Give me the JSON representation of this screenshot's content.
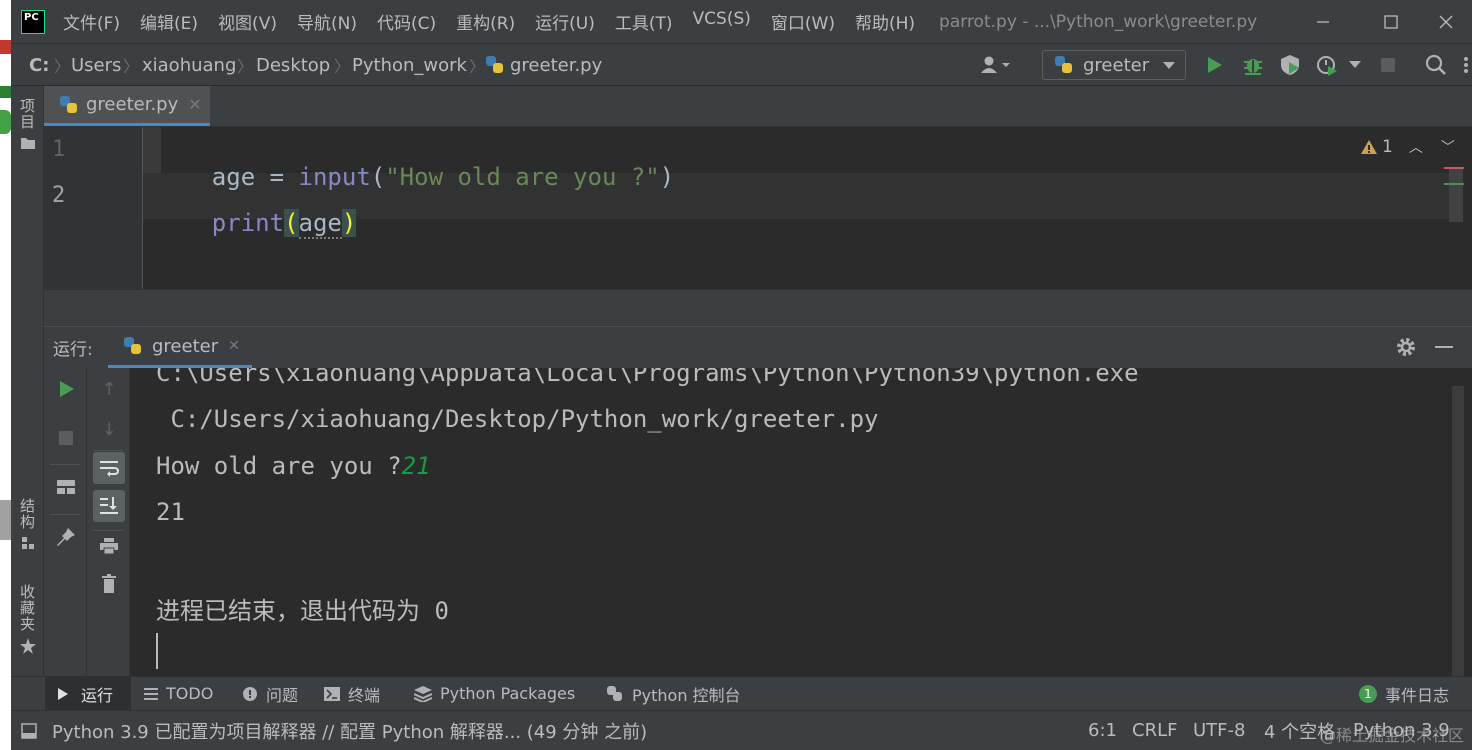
{
  "app": {
    "logo_text": "PC"
  },
  "menu": [
    "文件(F)",
    "编辑(E)",
    "视图(V)",
    "导航(N)",
    "代码(C)",
    "重构(R)",
    "运行(U)",
    "工具(T)",
    "VCS(S)",
    "窗口(W)",
    "帮助(H)"
  ],
  "window_title": "parrot.py - ...\\Python_work\\greeter.py",
  "breadcrumb": [
    "C:",
    "Users",
    "xiaohuang",
    "Desktop",
    "Python_work",
    "greeter.py"
  ],
  "run_config": {
    "label": "greeter"
  },
  "left_tool_windows": {
    "project": "项目",
    "structure": "结构",
    "bookmarks": "收藏夹"
  },
  "editor": {
    "tab_label": "greeter.py",
    "line_numbers": [
      "1",
      "2"
    ],
    "line1": {
      "ident": "age",
      "op": " = ",
      "func": "input",
      "paren_open": "(",
      "string": "\"How old are you ?\"",
      "paren_close": ")"
    },
    "line2": {
      "func": "print",
      "paren_open": "(",
      "arg": "age",
      "paren_close": ")"
    },
    "warning_count": "1"
  },
  "run_panel": {
    "label": "运行:",
    "tab_label": "greeter",
    "console": {
      "line1": "C:\\Users\\xiaohuang\\AppData\\Local\\Programs\\Python\\Python39\\python.exe",
      "line2": " C:/Users/xiaohuang/Desktop/Python_work/greeter.py",
      "prompt": "How old are you ?",
      "user_input": "21",
      "output": "21",
      "exit_message": "进程已结束，退出代码为 0"
    }
  },
  "bottom_tabs": [
    "运行",
    "TODO",
    "问题",
    "终端",
    "Python Packages",
    "Python 控制台"
  ],
  "event_log": {
    "count": "1",
    "label": "事件日志"
  },
  "status": {
    "message": "Python 3.9 已配置为项目解释器 // 配置 Python 解释器... (49 分钟 之前)",
    "position": "6:1",
    "line_sep": "CRLF",
    "encoding": "UTF-8",
    "indent": "4 个空格",
    "interpreter": "Python 3.9"
  },
  "watermark": "@稀土掘金技术社区",
  "colors": {
    "accent_green": "#499c54",
    "keyword_blue": "#8888c6",
    "string_green": "#6a8759",
    "user_input_green": "#1c9a3d",
    "tab_underline": "#4a88c7"
  }
}
